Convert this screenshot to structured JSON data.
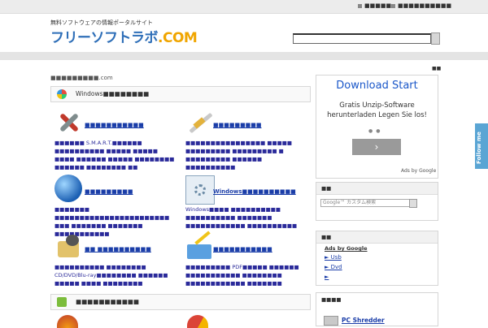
{
  "topbar": {
    "link1": "■■■■■",
    "link2": "■■■■■■■■■■"
  },
  "header": {
    "tagline": "無料ソフトウェアの情報ポータルサイト",
    "logo_main": "フリーソフトラボ",
    "logo_dot": ".",
    "logo_com": "COM",
    "search_value": ""
  },
  "corner_mark": "■■",
  "breadcrumb": "■■■■■■■■■.com",
  "sections": {
    "windows": {
      "title": "Windows■■■■■■■■"
    },
    "addons": {
      "title": "■■■■■■■■■■■"
    }
  },
  "categories": [
    {
      "title": "■■■■■■■■■■■",
      "desc": "■■■■■■ S.M.A.R.T.■■■■■■ ■■■■■■■■■■ ■■■■■ ■■■■■ ■■■■ ■■■■■■ ■■■■■ ■■■■■■■■ ■■■■■■ ■■■■■■■■ ■■"
    },
    {
      "title": "■■■■■■■■■",
      "desc": "■■■■■■■■■■■■■■■■ ■■■■■ ■■■■■■■■■ ■■■■■■■■■ ■ ■■■■■■■■■ ■■■■■■ ■■■■■■■■■■"
    },
    {
      "title": "■■■■■■■■■",
      "desc": "■■■■■■■ ■■■■■■■■■■■■■■■■■■■■■■■ ■■■ ■■■■■■■ ■■■■■■■ ■■■■■■■■■■■"
    },
    {
      "title": "Windows■■■■■■■■■■",
      "desc": "Windows■■■■ ■■■■■■■■■■ ■■■■■■■■■■ ■■■■■■■ ■■■■■■■■■■■■ ■■■■■■■■■■"
    },
    {
      "title": "■■ ■■■■■■■■■■",
      "desc": "■■■■■■■■■■ ■■■■■■■■ CD/DVD/Blu-ray■■■■■■■■ ■■■■■■ ■■■■■ ■■■■ ■■■■■■■■"
    },
    {
      "title": "■■■■■■■■■■■",
      "desc": "■■■■■■■■■ PDF■■■■■ ■■■■■■ ■■■■■■■■■■■ ■■■■■■■■ ■■■■■■■■■■■■ ■■■■■■■"
    }
  ],
  "ad": {
    "headline": "Download Start",
    "body_line1": "Gratis Unzip-Software",
    "body_line2": "herunterladen Legen Sie los!",
    "next_symbol": "›",
    "ads_by": "Ads by Google"
  },
  "sidebar": {
    "search_box": {
      "header": "■■",
      "placeholder": "Google™ カスタム検索"
    },
    "ads_box": {
      "header": "■■",
      "ads_by_label": "Ads by Google",
      "links": [
        "► Usb",
        "► Dvd",
        "►"
      ]
    },
    "featured_box": {
      "header": "■■■■",
      "item": "PC Shredder"
    }
  },
  "follow_me": "Follow me"
}
